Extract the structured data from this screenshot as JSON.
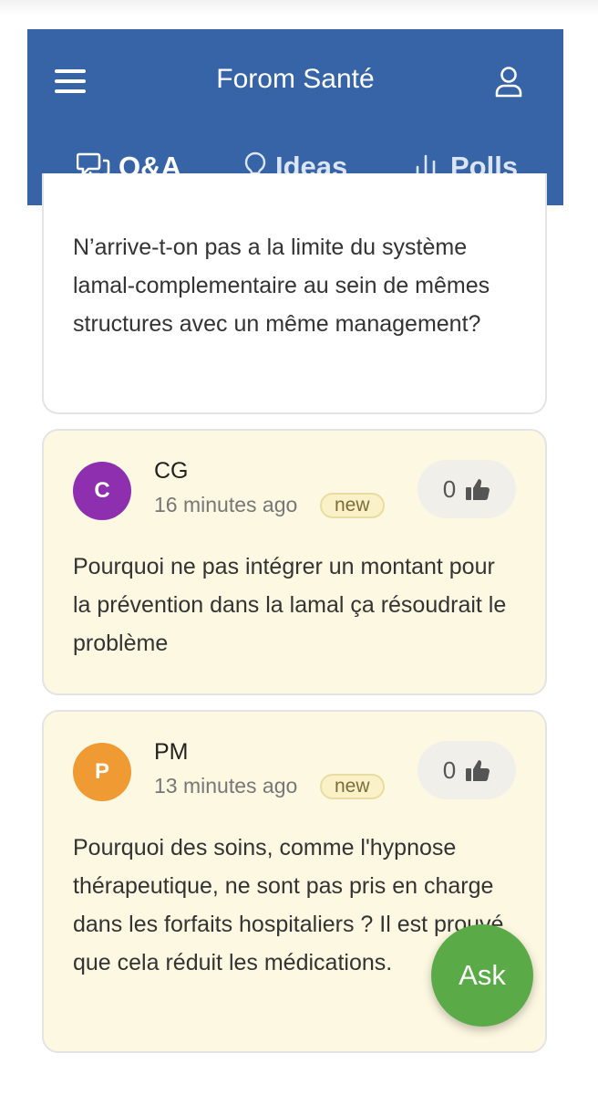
{
  "header": {
    "title": "Forom Santé",
    "tabs": [
      {
        "label": "Q&A",
        "icon": "chat-bubbles-icon",
        "active": true
      },
      {
        "label": "Ideas",
        "icon": "lightbulb-icon",
        "active": false
      },
      {
        "label": "Polls",
        "icon": "bar-chart-icon",
        "active": false
      }
    ]
  },
  "questions": [
    {
      "text": "N’arrive-t-on pas a la limite du système lamal-complementaire au sein de mêmes structures avec un même management?"
    },
    {
      "initial": "C",
      "author": "CG",
      "time": "16 minutes ago",
      "badge": "new",
      "votes": "0",
      "avatar_color": "#8e2fb0",
      "text": "Pourquoi ne pas intégrer un montant pour la prévention dans la lamal ça résoudrait le problème"
    },
    {
      "initial": "P",
      "author": "PM",
      "time": "13 minutes ago",
      "badge": "new",
      "votes": "0",
      "avatar_color": "#f09a34",
      "text": "Pourquoi des soins, comme l'hypnose thérapeutique, ne sont pas pris en charge dans les forfaits hospitaliers ? Il est prouvé que cela réduit les médications."
    }
  ],
  "fab": {
    "label": "Ask"
  },
  "colors": {
    "header": "#3664a6",
    "question_bg": "#fdf8e1",
    "fab": "#5aab47"
  }
}
